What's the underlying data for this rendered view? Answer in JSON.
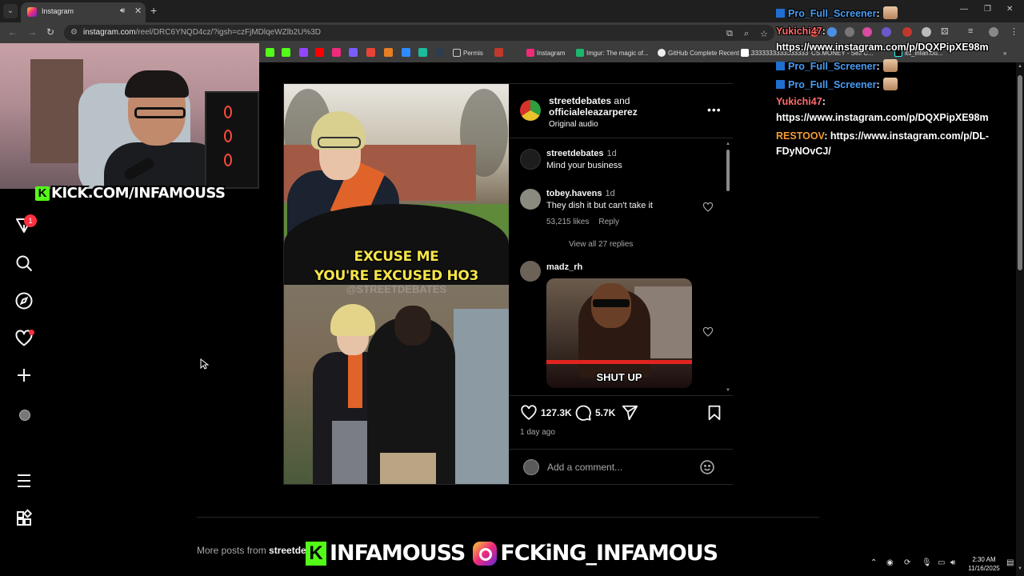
{
  "browser": {
    "tab_title": "Instagram",
    "url_host": "instagram.com",
    "url_path": "/reel/DRC6YNQD4cz/?igsh=czFjMDlqeWZlb2U%3D",
    "bookmarks": [
      "Permis",
      "Instagram",
      "Imgur: The magic of...",
      "GitHub Complete Recent Di...",
      "3333333333333333",
      "CS.MONEY - Sell C...",
      "its_infamou..."
    ]
  },
  "stream": {
    "kick_overlay": "KICK.COM/INFAMOUSS",
    "banner_kick": "INFAMOUSS",
    "banner_ig": "FCKiNG_INFAMOUS"
  },
  "nav": {
    "notification_count": "1"
  },
  "post": {
    "author": "streetdebates",
    "and": "and",
    "coauthor": "officialeleazarperez",
    "audio": "Original audio",
    "video_caption_line1": "EXCUSE ME",
    "video_caption_line2": "YOU'RE EXCUSED HO3",
    "video_watermark": "@STREETDEBATES",
    "likes": "127.3K",
    "comments_count": "5.7K",
    "date": "1 day ago",
    "add_comment_placeholder": "Add a comment..."
  },
  "comments": [
    {
      "user": "streetdebates",
      "time": "1d",
      "text": "Mind your business"
    },
    {
      "user": "tobey.havens",
      "time": "1d",
      "text": "They dish it but can't take it",
      "likes": "53,215 likes",
      "reply": "Reply",
      "view_replies": "View all 27 replies"
    },
    {
      "user": "madz_rh",
      "gif_text": "SHUT UP"
    }
  ],
  "more_posts": {
    "prefix": "More posts from",
    "user": "streetde"
  },
  "chat": [
    {
      "user": "Pro_Full_Screener",
      "sep": ":",
      "user_color": "#4a9cf2"
    },
    {
      "user": "Yukichi47",
      "sep": ":",
      "user_color": "#ff6b6b",
      "message": "https://www.instagram.com/p/DQXPipXE98m"
    },
    {
      "user": "Pro_Full_Screener",
      "sep": ":",
      "user_color": "#4a9cf2"
    },
    {
      "user": "Pro_Full_Screener",
      "sep": ":",
      "user_color": "#4a9cf2"
    },
    {
      "user": "Yukichi47",
      "sep": ":",
      "user_color": "#ff6b6b",
      "message": "https://www.instagram.com/p/DQXPipXE98m"
    },
    {
      "user": "RESTOOV",
      "sep": ":",
      "user_color": "#f29b38",
      "message": "https://www.instagram.com/p/DL-",
      "message2": "FDyNOvCJ/"
    }
  ],
  "taskbar": {
    "time": "2:30 AM",
    "date": "11/16/2025"
  },
  "colors": {
    "kick_green": "#53fc18",
    "notification_red": "#ff3040"
  }
}
